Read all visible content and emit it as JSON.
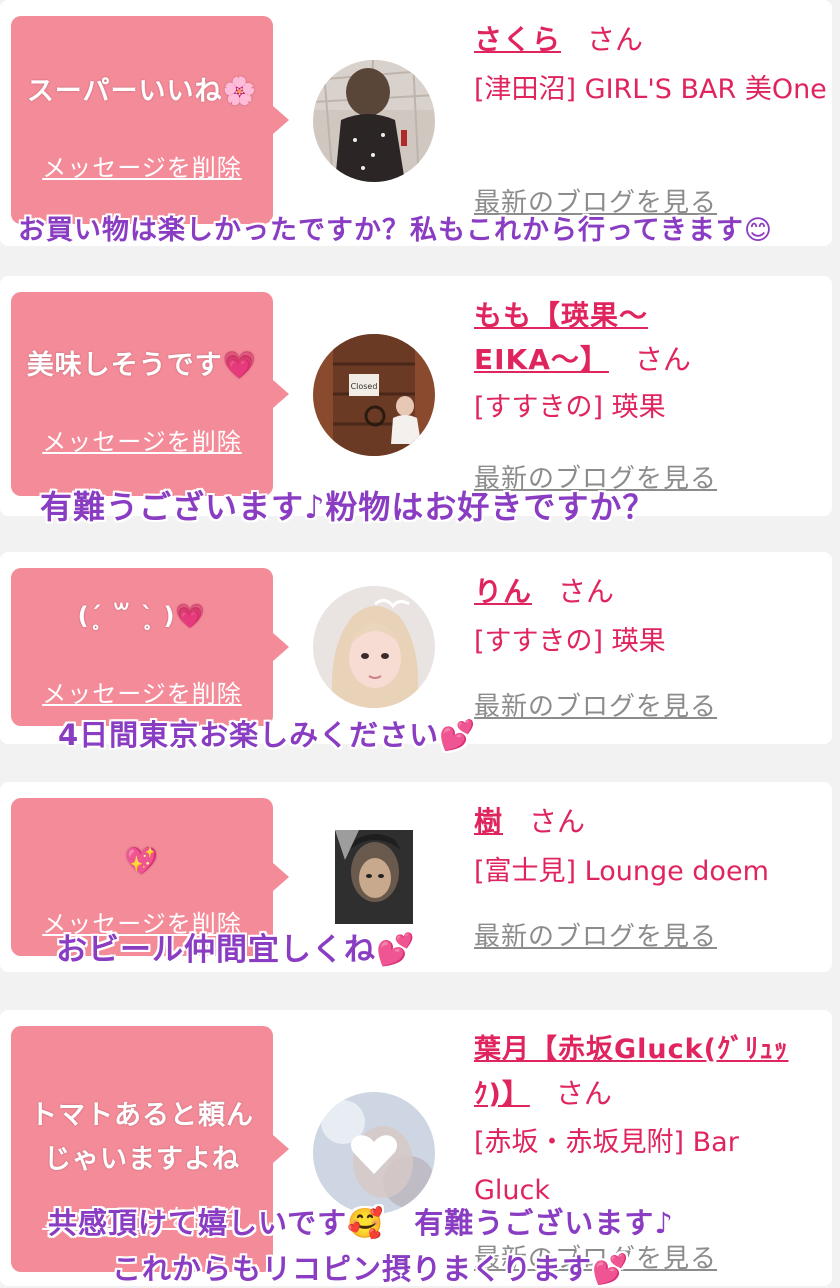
{
  "delete_label": "メッセージを削除",
  "blog_label": "最新のブログを見る",
  "san_label": "さん",
  "colors": {
    "bubble": "#f48b99",
    "name": "#e0245e",
    "caption": "#8a3cc2",
    "blog": "#8c8c8c"
  },
  "entries": [
    {
      "message": "スーパーいいね🌸",
      "name": "さくら",
      "shop": "[津田沼] GIRL'S BAR 美One",
      "caption": "お買い物は楽しかったですか？私もこれから行ってきます😊"
    },
    {
      "message": "美味しそうです💗",
      "name": "もも【瑛果～EIKA～】",
      "name_line1": "もも【瑛果～",
      "name_line2": "EIKA～】",
      "shop": "[すすきの] 瑛果",
      "caption": "有難うございます♪粉物はお好きですか？"
    },
    {
      "message": "(ˊ̥ ꒳ ˋ̥ )💗",
      "name": "りん",
      "shop": "[すすきの] 瑛果",
      "caption": "4日間東京お楽しみください💕"
    },
    {
      "message": "💖",
      "name": "樹",
      "shop": "[富士見] Lounge doem",
      "caption": "おビール仲間宜しくね💕"
    },
    {
      "message_line1": "トマトあると頼ん",
      "message_line2": "じゃいますよね",
      "name_line1": "葉月【赤坂Gluck(ｸﾞﾘｭｯ",
      "name_line2": "ｸ)】",
      "shop_line1": "[赤坂・赤坂見附] Bar",
      "shop_line2": "Gluck",
      "caption_line1": "共感頂けて嬉しいです🥰　有難うございます♪",
      "caption_line2": "これからもリコピン摂りまくります💕"
    }
  ]
}
